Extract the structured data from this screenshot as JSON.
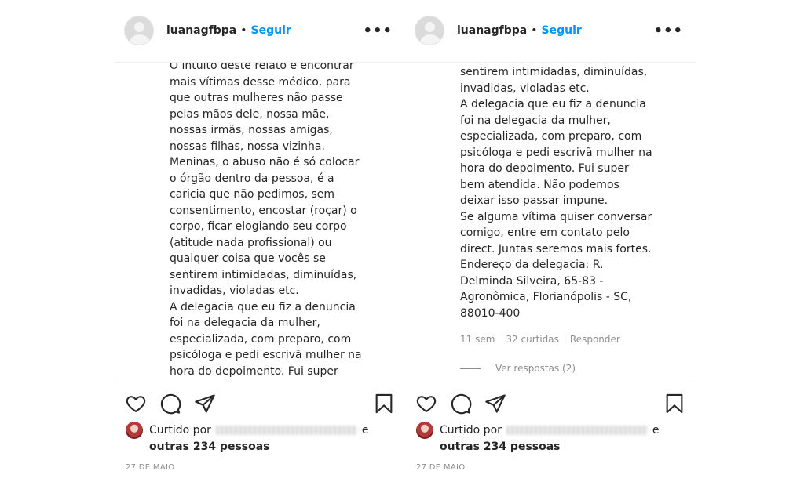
{
  "panels": [
    {
      "username": "luanagfbpa",
      "separator": "•",
      "follow_label": "Seguir",
      "more_label": "•••",
      "caption": "O intuito deste relato é encontrar\nmais vítimas desse médico, para\nque outras mulheres não passe\npelas mãos dele, nossa mãe,\nnossas irmãs, nossas amigas,\nnossas filhas, nossa vizinha.\nMeninas, o abuso não é só colocar\no órgão dentro da pessoa, é a\ncaricia que não pedimos, sem\nconsentimento, encostar (roçar) o\ncorpo, ficar elogiando seu corpo\n(atitude nada profissional) ou\nqualquer coisa que vocês se\nsentirem intimidadas, diminuídas,\ninvadidas, violadas etc.\nA delegacia que eu fiz a denuncia\nfoi na delegacia da mulher,\nespecializada, com preparo, com\npsicóloga e pedi escrivã mulher na\nhora do depoimento. Fui super",
      "likes_prefix": "Curtido por",
      "likes_e": "e",
      "likes_others": "outras 234 pessoas",
      "date": "27 DE MAIO",
      "icons": [
        "heart-icon",
        "comment-icon",
        "share-icon",
        "bookmark-icon"
      ]
    },
    {
      "username": "luanagfbpa",
      "separator": "•",
      "follow_label": "Seguir",
      "more_label": "•••",
      "caption": "sentirem intimidadas, diminuídas,\ninvadidas, violadas etc.\nA delegacia que eu fiz a denuncia\nfoi na delegacia da mulher,\nespecializada, com preparo, com\npsicóloga e pedi escrivã mulher na\nhora do depoimento. Fui super\nbem atendida. Não podemos\ndeixar isso passar impune.\nSe alguma vítima quiser conversar\ncomigo, entre em contato pelo\ndirect. Juntas seremos mais fortes.\nEndereço da delegacia: R.\nDelminda Silveira, 65-83 -\nAgronômica, Florianópolis - SC,\n88010-400",
      "comment_time": "11 sem",
      "comment_likes": "32 curtidas",
      "reply_label": "Responder",
      "view_replies": "Ver respostas (2)",
      "likes_prefix": "Curtido por",
      "likes_e": "e",
      "likes_others": "outras 234 pessoas",
      "date": "27 DE MAIO",
      "icons": [
        "heart-icon",
        "comment-icon",
        "share-icon",
        "bookmark-icon"
      ]
    }
  ],
  "colors": {
    "follow_blue": "#0095f6",
    "text": "#262626",
    "muted": "#8e8e8e",
    "divider": "#efefef"
  }
}
